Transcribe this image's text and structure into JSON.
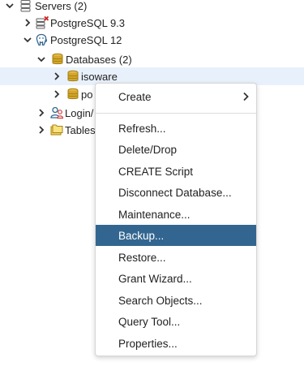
{
  "tree": {
    "servers_label": "Servers (2)",
    "pg93_label": "PostgreSQL 9.3",
    "pg12_label": "PostgreSQL 12",
    "databases_label": "Databases (2)",
    "isoware_label": "isoware",
    "postgres_partial_label": "po",
    "login_partial_label": "Login/",
    "tables_partial_label": "Tables"
  },
  "context_menu": {
    "create_label": "Create",
    "items": [
      "Refresh...",
      "Delete/Drop",
      "CREATE Script",
      "Disconnect Database...",
      "Maintenance...",
      "Backup...",
      "Restore...",
      "Grant Wizard...",
      "Search Objects...",
      "Query Tool...",
      "Properties..."
    ],
    "active_item": "Backup..."
  },
  "colors": {
    "menu_highlight": "#326690",
    "selection": "#e8f1fb",
    "db_icon": "#d4a72c"
  }
}
